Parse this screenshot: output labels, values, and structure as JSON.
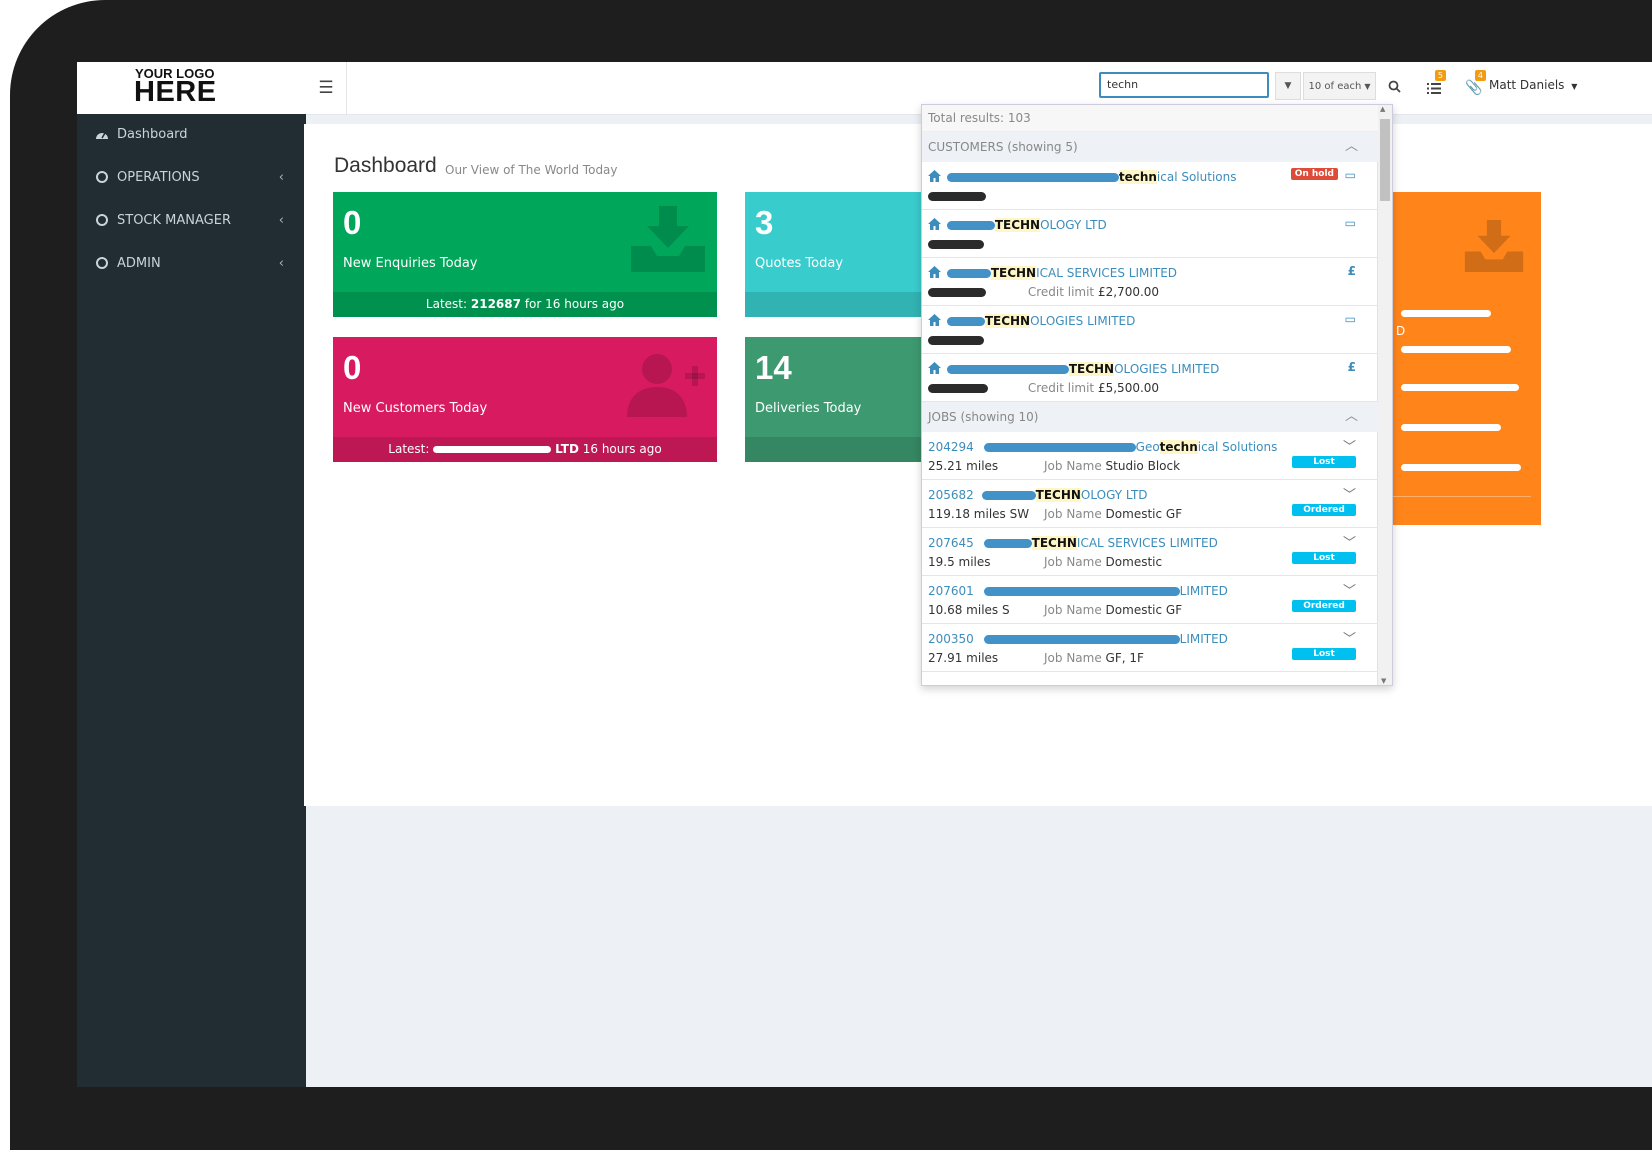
{
  "logo": {
    "top": "YOUR LOGO",
    "main": "HERE"
  },
  "sidebar": {
    "items": [
      {
        "label": "Dashboard"
      },
      {
        "label": "OPERATIONS"
      },
      {
        "label": "STOCK MANAGER"
      },
      {
        "label": "ADMIN"
      }
    ]
  },
  "topbar": {
    "search_value": "techn",
    "per_type": "10 of each",
    "user_name": "Matt Daniels",
    "tasks_count": "5",
    "notes_count": "4"
  },
  "page": {
    "title": "Dashboard",
    "subtitle": "Our View of The World Today"
  },
  "boxes": [
    {
      "value": "0",
      "label": "New Enquiries Today",
      "footer_prefix": "Latest:",
      "footer_bold": "212687",
      "footer_suffix": "for 16 hours ago",
      "color": "#00a65a"
    },
    {
      "value": "3",
      "label": "Quotes Today",
      "color": "#39cccc"
    },
    {
      "value": "0",
      "label": "New Customers Today",
      "footer_prefix": "Latest:",
      "footer_bold": "LTD",
      "footer_suffix": "16 hours ago",
      "color": "#d81b60"
    },
    {
      "value": "14",
      "label": "Deliveries Today",
      "color": "#3d9970"
    },
    {
      "partial_text": "D",
      "color": "#ff851b"
    }
  ],
  "search_results": {
    "total": "Total results: 103",
    "customers_heading": "CUSTOMERS (showing 5)",
    "customers": [
      {
        "hl": "techn",
        "rest": "ical Solutions",
        "badge": "On hold"
      },
      {
        "hl": "TECHN",
        "rest": "OLOGY LTD"
      },
      {
        "hl": "TECHN",
        "rest": "ICAL SERVICES LIMITED",
        "credit_label": "Credit limit",
        "credit": "£2,700.00"
      },
      {
        "hl": "TECHN",
        "rest": "OLOGIES LIMITED"
      },
      {
        "hl": "TECHN",
        "rest": "OLOGIES LIMITED",
        "credit_label": "Credit limit",
        "credit": "£5,500.00"
      }
    ],
    "jobs_heading": "JOBS (showing 10)",
    "job_name_label": "Job Name",
    "jobs": [
      {
        "id": "204294",
        "pre": "Geo",
        "hl": "techn",
        "rest": "ical Solutions",
        "distance": "25.21 miles",
        "job_name": "Studio Block",
        "status": "Lost"
      },
      {
        "id": "205682",
        "pre": "",
        "hl": "TECHN",
        "rest": "OLOGY LTD",
        "distance": "119.18 miles SW",
        "job_name": "Domestic GF",
        "status": "Ordered"
      },
      {
        "id": "207645",
        "pre": "",
        "hl": "TECHN",
        "rest": "ICAL SERVICES LIMITED",
        "distance": "19.5 miles",
        "job_name": "Domestic",
        "status": "Lost"
      },
      {
        "id": "207601",
        "pre": "",
        "hl": "",
        "rest": "LIMITED",
        "distance": "10.68 miles S",
        "job_name": "Domestic GF",
        "status": "Ordered"
      },
      {
        "id": "200350",
        "pre": "",
        "hl": "",
        "rest": "LIMITED",
        "distance": "27.91 miles",
        "job_name": "GF, 1F",
        "status": "Lost"
      }
    ]
  },
  "colors": {
    "accent": "#3c8dbc",
    "sidebar": "#212d33",
    "status_blue": "#00c0ef",
    "danger": "#dd4b39"
  }
}
